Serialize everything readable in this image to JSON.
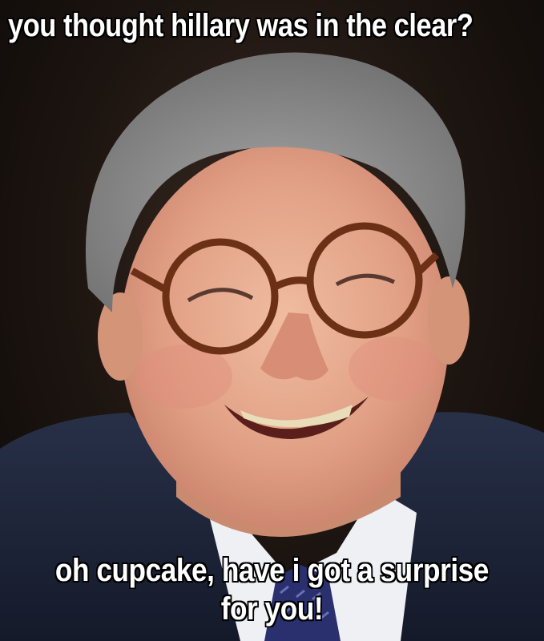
{
  "captions": {
    "top": "you thought hillary was in the clear?",
    "bottom_line1": "oh cupcake, have i got a surprise",
    "bottom_line2": "for you!"
  },
  "colors": {
    "caption_text": "#ffffff",
    "caption_outline": "#000000",
    "suit": "#1e2538",
    "shirt": "#eef0f4",
    "tie": "#2a2f6e",
    "hair": "#8e8e8e",
    "skin": "#e3a98a"
  }
}
